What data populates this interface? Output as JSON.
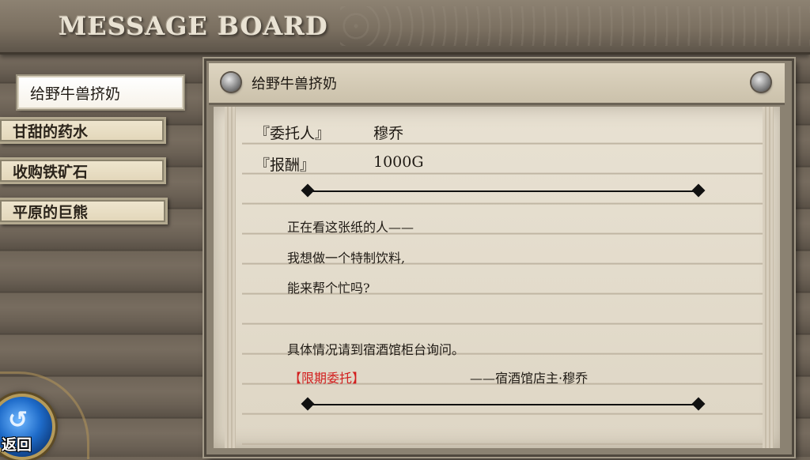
{
  "header": {
    "title": "MESSAGE BOARD"
  },
  "menu": {
    "items": [
      {
        "label": "给野牛兽挤奶",
        "active": true
      },
      {
        "label": "甘甜的药水"
      },
      {
        "label": "收购铁矿石"
      },
      {
        "label": "平原的巨熊"
      }
    ]
  },
  "quest": {
    "title": "给野牛兽挤奶",
    "client_label": "『委托人』",
    "client_value": "穆乔",
    "reward_label": "『报酬』",
    "reward_value": "1000G",
    "message": [
      "正在看这张纸的人——",
      "我想做一个特制饮料,",
      "能来帮个忙吗?",
      "具体情况请到宿酒馆柜台询问。"
    ],
    "tag": "【限期委托】",
    "signature": "——宿酒馆店主·穆乔"
  },
  "back": {
    "label": "返回",
    "icon": "return-arrow-icon"
  },
  "colors": {
    "tag_red": "#d21e1e",
    "back_blue": "#1e6bc9"
  }
}
